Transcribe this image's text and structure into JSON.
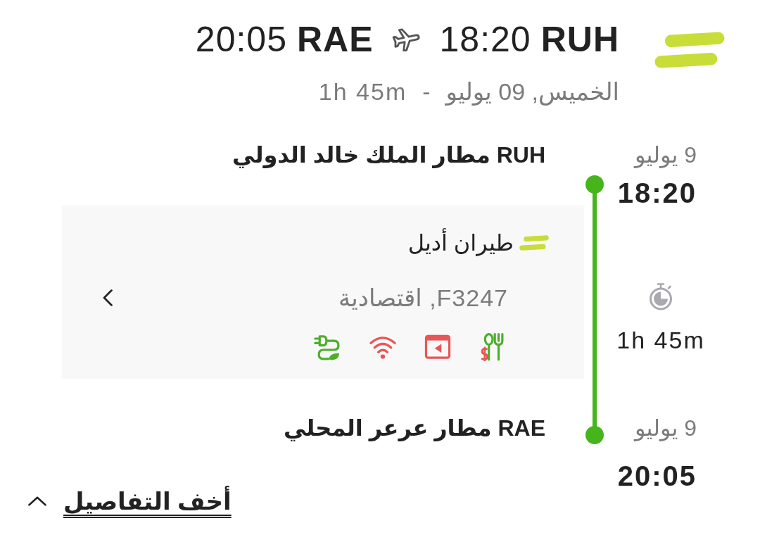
{
  "header": {
    "departure": {
      "time": "18:20",
      "code": "RUH"
    },
    "arrival": {
      "time": "20:05",
      "code": "RAE"
    },
    "date": "الخميس, 09 يوليو",
    "separator": "-",
    "duration": "1h 45m"
  },
  "itinerary": {
    "departure": {
      "date": "9 يوليو",
      "time": "18:20",
      "airport": "RUH مطار الملك خالد الدولي"
    },
    "segment": {
      "airline": "طيران أديل",
      "flight": "F3247, اقتصادية",
      "duration": "1h 45m",
      "amenities": [
        {
          "kind": "meal",
          "available": true,
          "paid": true
        },
        {
          "kind": "entertainment",
          "available": false,
          "paid": false
        },
        {
          "kind": "wifi",
          "available": false,
          "paid": false
        },
        {
          "kind": "eco",
          "available": true,
          "paid": false
        }
      ]
    },
    "arrival": {
      "date": "9 يوليو",
      "time": "20:05",
      "airport": "RAE مطار عرعر المحلي"
    }
  },
  "toggle": {
    "label": "أخف التفاصيل",
    "expanded": true
  }
}
